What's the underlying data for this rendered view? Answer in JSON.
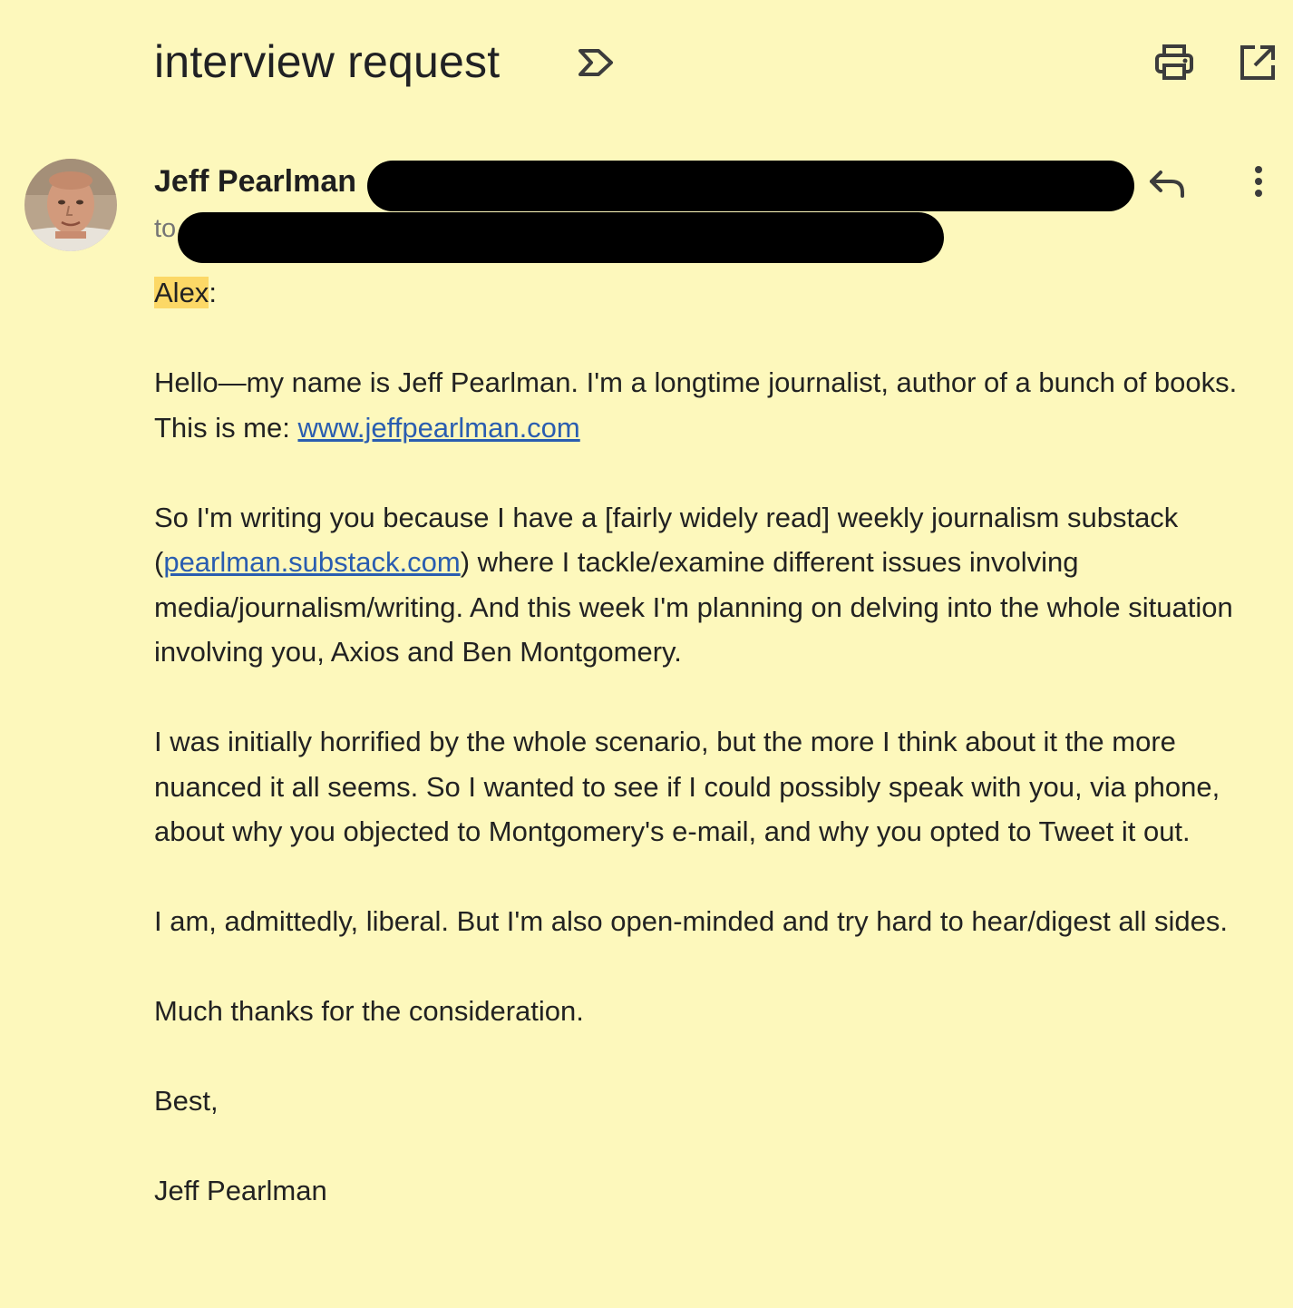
{
  "email": {
    "subject": "interview request",
    "sender_name": "Jeff Pearlman",
    "to_label": "to",
    "greeting_name": "Alex",
    "greeting_punct": ":",
    "para1_text": "Hello—my name is Jeff Pearlman. I'm a longtime journalist, author of a bunch of books. This is me: ",
    "para1_link": "www.jeffpearlman.com",
    "para2_open": "So I'm writing you because I have a [fairly widely read] weekly journalism substack (",
    "para2_link": "pearlman.substack.com",
    "para2_rest": ") where I tackle/examine different issues involving media/journalism/writing. And this week I'm planning on delving into the whole situation involving you, Axios and Ben Montgomery.",
    "para3": "I was initially horrified by the whole scenario, but the more I think about it the more nuanced it all seems. So I wanted to see if I could possibly speak with you, via phone, about why you objected to Montgomery's e-mail, and why you opted to Tweet it out.",
    "para4": "I am, admittedly, liberal. But I'm also open-minded and try hard to hear/digest all sides.",
    "para5": "Much thanks for the consideration.",
    "signoff": "Best,",
    "signature": "Jeff Pearlman"
  },
  "icons": {
    "label": "label-outline-icon",
    "print": "printer-icon",
    "popout": "open-in-new-window-icon",
    "reply": "reply-arrow-icon",
    "more": "more-vertical-icon"
  },
  "colors": {
    "background": "#fdf8bc",
    "link": "#2a5db0",
    "highlight": "#fcd866",
    "redaction": "#000000"
  }
}
